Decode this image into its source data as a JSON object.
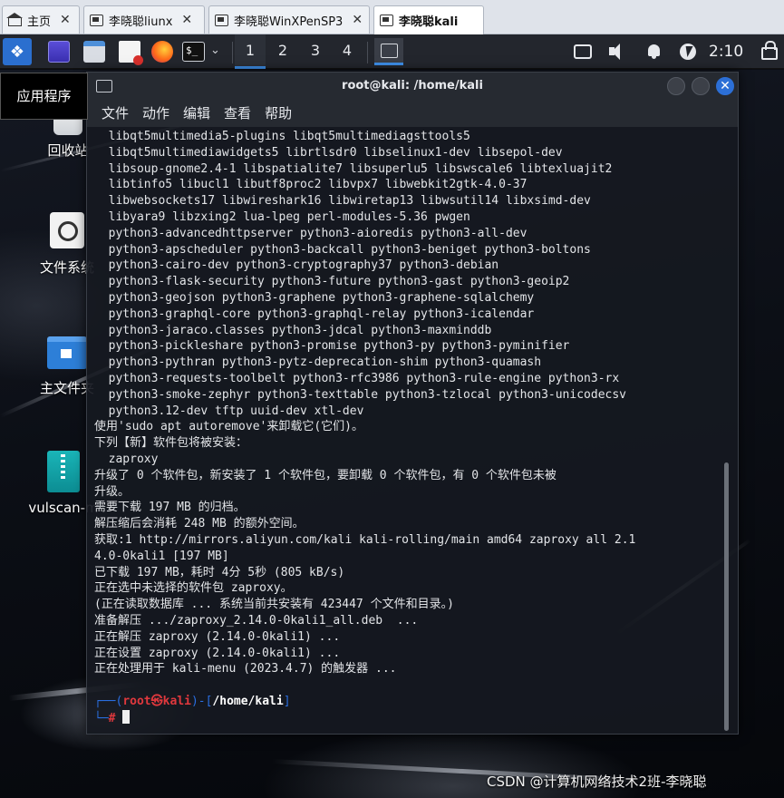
{
  "vm_tabs": [
    {
      "label": "主页",
      "icon": "home-icon"
    },
    {
      "label": "李晓聪liunx",
      "icon": "vm-icon"
    },
    {
      "label": "李晓聪WinXPenSP3",
      "icon": "vm-icon"
    },
    {
      "label": "李晓聪kali",
      "icon": "vm-icon",
      "active": true
    }
  ],
  "panel": {
    "workspaces": [
      "1",
      "2",
      "3",
      "4"
    ],
    "active_workspace": "1",
    "clock": "2:10",
    "accent": "#3d8ee8"
  },
  "desktop": {
    "apps_tooltip": "应用程序",
    "icons": [
      {
        "label": "回收站"
      },
      {
        "label": "文件系统"
      },
      {
        "label": "主文件夹"
      },
      {
        "label": "vulscan-m"
      }
    ]
  },
  "terminal": {
    "title": "root@kali: /home/kali",
    "menu": [
      "文件",
      "动作",
      "编辑",
      "查看",
      "帮助"
    ],
    "output": "  libqt5multimedia5-plugins libqt5multimediagsttools5\n  libqt5multimediawidgets5 librtlsdr0 libselinux1-dev libsepol-dev\n  libsoup-gnome2.4-1 libspatialite7 libsuperlu5 libswscale6 libtexluajit2\n  libtinfo5 libucl1 libutf8proc2 libvpx7 libwebkit2gtk-4.0-37\n  libwebsockets17 libwireshark16 libwiretap13 libwsutil14 libxsimd-dev\n  libyara9 libzxing2 lua-lpeg perl-modules-5.36 pwgen\n  python3-advancedhttpserver python3-aioredis python3-all-dev\n  python3-apscheduler python3-backcall python3-beniget python3-boltons\n  python3-cairo-dev python3-cryptography37 python3-debian\n  python3-flask-security python3-future python3-gast python3-geoip2\n  python3-geojson python3-graphene python3-graphene-sqlalchemy\n  python3-graphql-core python3-graphql-relay python3-icalendar\n  python3-jaraco.classes python3-jdcal python3-maxminddb\n  python3-pickleshare python3-promise python3-py python3-pyminifier\n  python3-pythran python3-pytz-deprecation-shim python3-quamash\n  python3-requests-toolbelt python3-rfc3986 python3-rule-engine python3-rx\n  python3-smoke-zephyr python3-texttable python3-tzlocal python3-unicodecsv\n  python3.12-dev tftp uuid-dev xtl-dev\n使用'sudo apt autoremove'来卸载它(它们)。\n下列【新】软件包将被安装：\n  zaproxy\n升级了 0 个软件包，新安装了 1 个软件包，要卸载 0 个软件包，有 0 个软件包未被\n升级。\n需要下载 197 MB 的归档。\n解压缩后会消耗 248 MB 的额外空间。\n获取:1 http://mirrors.aliyun.com/kali kali-rolling/main amd64 zaproxy all 2.1\n4.0-0kali1 [197 MB]\n已下载 197 MB，耗时 4分 5秒 (805 kB/s)\n正在选中未选择的软件包 zaproxy。\n(正在读取数据库 ... 系统当前共安装有 423447 个文件和目录。)\n准备解压 .../zaproxy_2.14.0-0kali1_all.deb  ...\n正在解压 zaproxy (2.14.0-0kali1) ...\n正在设置 zaproxy (2.14.0-0kali1) ...\n正在处理用于 kali-menu (2023.4.7) 的触发器 ...",
    "prompt": {
      "frame_open": "┌──(",
      "user_host": "root㉿kali",
      "frame_mid": ")-[",
      "path": "/home/kali",
      "frame_close": "]",
      "line2_prefix": "└─",
      "hash": "#"
    }
  },
  "watermark": "CSDN @计算机网络技术2班-李晓聪"
}
